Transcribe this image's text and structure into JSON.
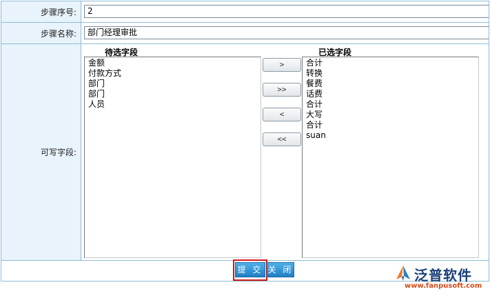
{
  "form": {
    "step_no": {
      "label": "步骤序号:",
      "value": "2"
    },
    "step_name": {
      "label": "步骤名称:",
      "value": "部门经理审批"
    },
    "writable": {
      "label": "可写字段:",
      "available_header": "待选字段",
      "selected_header": "已选字段",
      "available_items": [
        "金额",
        "付款方式",
        "部门",
        "部门",
        "人员"
      ],
      "selected_items": [
        "合计",
        "转换",
        "餐费",
        "话费",
        "合计",
        "大写",
        "合计",
        "suan"
      ],
      "move_buttons": [
        ">",
        ">>",
        "<",
        "<<"
      ]
    }
  },
  "actions": {
    "submit": "提 交",
    "close": "关 闭"
  },
  "logo": {
    "name": "泛普软件",
    "url": "www.fanpusoft.com",
    "icon": "fanpu-logo-icon"
  },
  "colors": {
    "label_bg": "#e8f3fb",
    "border": "#8fbcd4",
    "button": "#2b8bd0",
    "highlight": "#d01a1a"
  }
}
